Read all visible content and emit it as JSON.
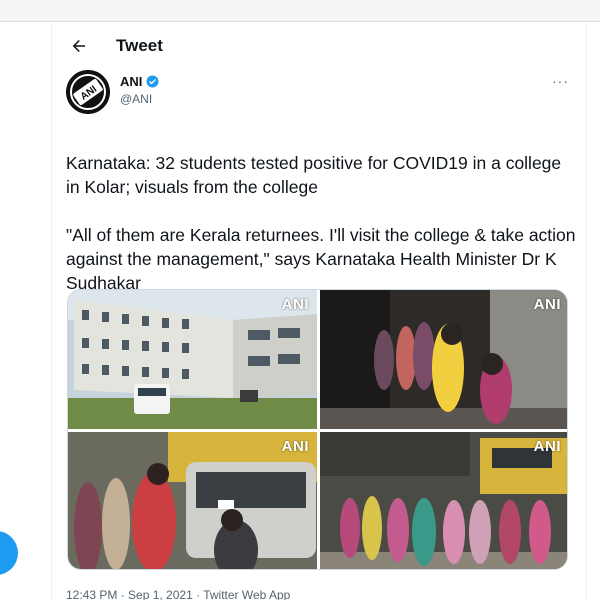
{
  "header": {
    "title": "Tweet",
    "back_icon": "arrow-left-icon"
  },
  "tweet": {
    "author_name": "ANI",
    "verified_icon": "verified-badge-icon",
    "handle": "@ANI",
    "more_icon": "more-dots-icon",
    "more_label": "···",
    "paragraphs": [
      "Karnataka: 32 students tested positive for COVID19 in a college in Kolar; visuals from the college",
      "\"All of them are Kerala returnees. I'll visit the college & take action against the management,\" says Karnataka Health Minister Dr K Sudhakar"
    ],
    "photos": [
      {
        "watermark": "ANI"
      },
      {
        "watermark": "ANI"
      },
      {
        "watermark": "ANI"
      },
      {
        "watermark": "ANI"
      }
    ],
    "meta": "12:43 PM · Sep 1, 2021 · Twitter Web App"
  },
  "colors": {
    "accent": "#1d9bf0",
    "text": "#0f1419",
    "muted": "#536471"
  }
}
